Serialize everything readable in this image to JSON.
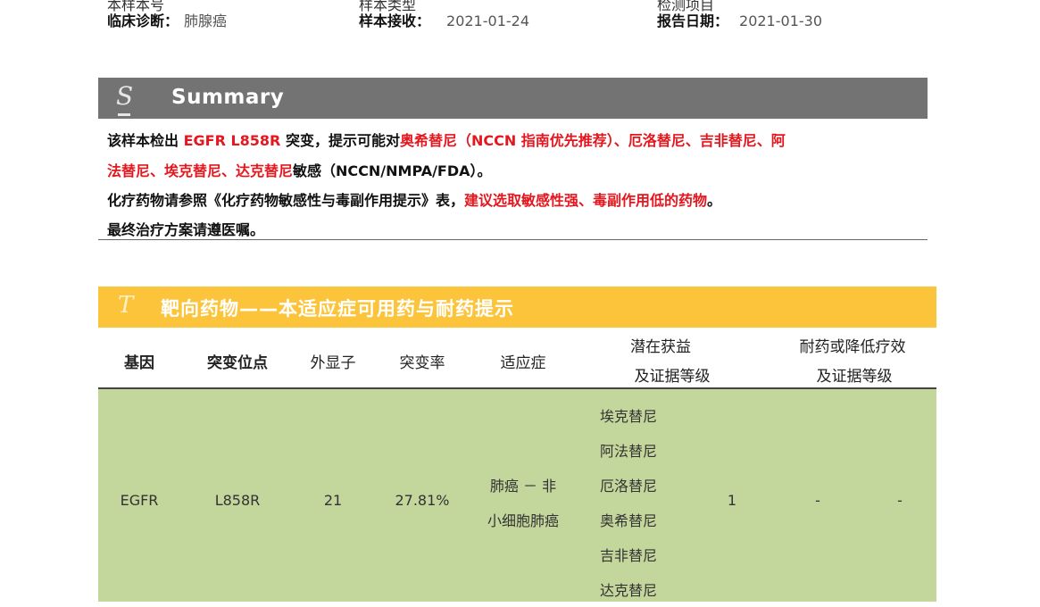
{
  "top_partial": {
    "left": "本样本号",
    "middle": "样本类型",
    "right": "检测项目"
  },
  "info": {
    "diagnosis_label": "临床诊断：",
    "diagnosis_value": "肺腺癌",
    "received_label": "样本接收：",
    "received_value": "2021-01-24",
    "report_label": "报告日期：",
    "report_value": "2021-01-30"
  },
  "summary": {
    "letter": "S",
    "title": "Summary",
    "line1": {
      "p1": "该样本检出 ",
      "p2": "EGFR L858R",
      "p3": " 突变，提示可能对",
      "p4": "奥希替尼（NCCN 指南优先推荐）、厄洛替尼、吉非替尼、阿"
    },
    "line2": {
      "p1": "法替尼、埃克替尼、达克替尼",
      "p2": "敏感（NCCN/NMPA/FDA）。"
    },
    "line3": {
      "p1": "化疗药物请参照《化疗药物敏感性与毒副作用提示》表，",
      "p2": "建议选取敏感性强、毒副作用低的药物",
      "p3": "。"
    },
    "line4": "最终治疗方案请遵医嘱。"
  },
  "targeted": {
    "letter": "T",
    "title": "靶向药物——本适应症可用药与耐药提示",
    "headers": {
      "gene": "基因",
      "site": "突变位点",
      "exon": "外显子",
      "rate": "突变率",
      "indication": "适应症",
      "benefit_1": "潜在获益",
      "benefit_2": "及证据等级",
      "resist_1": "耐药或降低疗效",
      "resist_2": "及证据等级"
    },
    "row": {
      "gene": "EGFR",
      "site": "L858R",
      "exon": "21",
      "rate": "27.81%",
      "indication_1": "肺癌 － 非",
      "indication_2": "小细胞肺癌",
      "drugs": [
        "埃克替尼",
        "阿法替尼",
        "厄洛替尼",
        "奥希替尼",
        "吉非替尼",
        "达克替尼"
      ],
      "evidence": "1",
      "resist_drug": "-",
      "resist_level": "-"
    }
  },
  "colors": {
    "summary_bar": "#737373",
    "targeted_bar": "#fbc43a",
    "row_fill": "#c3d69b",
    "highlight_red": "#e6161e"
  }
}
